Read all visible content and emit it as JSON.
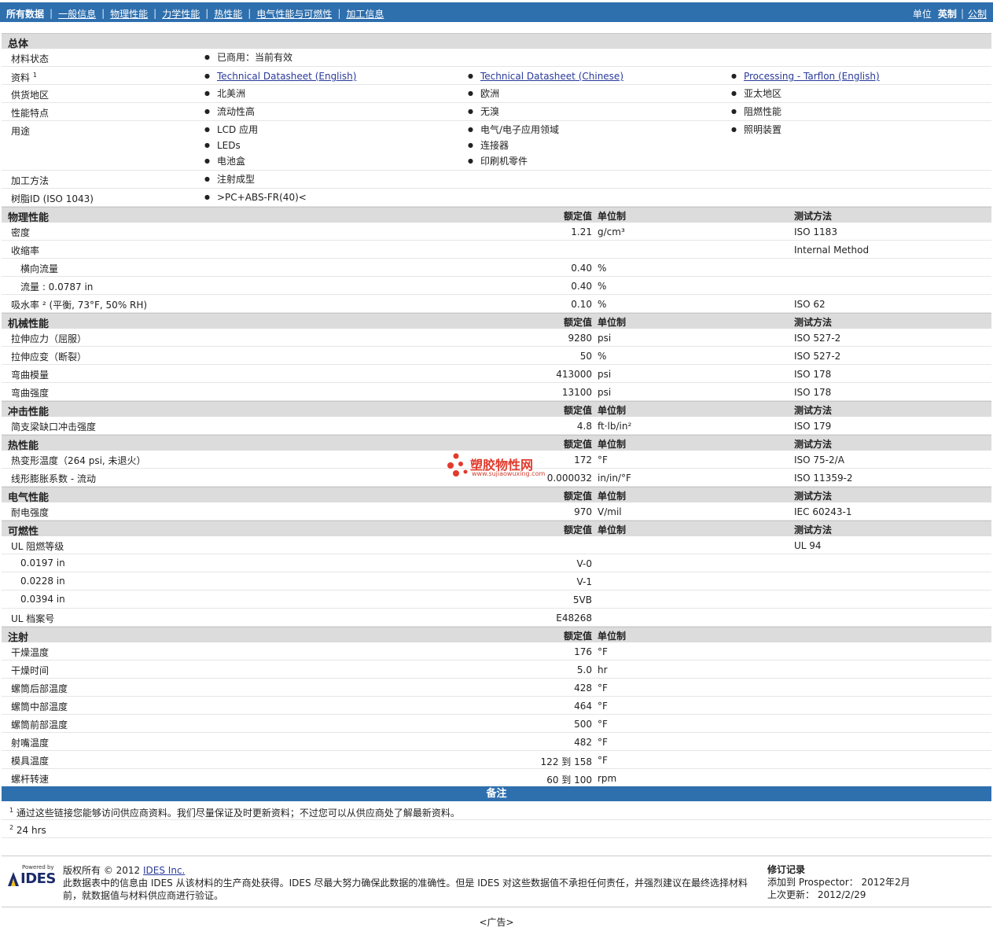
{
  "nav": {
    "tabs": [
      "所有数据",
      "一般信息",
      "物理性能",
      "力学性能",
      "热性能",
      "电气性能与可燃性",
      "加工信息"
    ],
    "units_label": "单位",
    "unit_selected": "英制",
    "unit_other": "公制"
  },
  "headers": {
    "value": "额定值",
    "unit": "单位制",
    "method": "测试方法"
  },
  "general": {
    "title": "总体",
    "status_label": "材料状态",
    "status": "已商用：当前有效",
    "docs_label": "资料",
    "docs_sup": "1",
    "docs": [
      "Technical Datasheet (English)",
      "Technical Datasheet (Chinese)",
      "Processing - Tarflon (English)"
    ],
    "region_label": "供货地区",
    "regions": [
      "北美洲",
      "欧洲",
      "亚太地区"
    ],
    "features_label": "性能特点",
    "features": [
      "流动性高",
      "无溴",
      "阻燃性能"
    ],
    "uses_label": "用途",
    "uses_col1": [
      "LCD 应用",
      "LEDs",
      "电池盒"
    ],
    "uses_col2": [
      "电气/电子应用领域",
      "连接器",
      "印刷机零件"
    ],
    "uses_col3": [
      "照明装置"
    ],
    "process_label": "加工方法",
    "process": "注射成型",
    "resin_label": "树脂ID (ISO 1043)",
    "resin": ">PC+ABS-FR(40)<"
  },
  "physical": {
    "title": "物理性能",
    "rows": [
      {
        "label": "密度",
        "value": "1.21",
        "unit": "g/cm³",
        "method": "ISO 1183",
        "indent": false
      },
      {
        "label": "收缩率",
        "value": "",
        "unit": "",
        "method": "Internal Method",
        "indent": false
      },
      {
        "label": "横向流量",
        "value": "0.40",
        "unit": "%",
        "method": "",
        "indent": true
      },
      {
        "label": "流量 : 0.0787 in",
        "value": "0.40",
        "unit": "%",
        "method": "",
        "indent": true
      },
      {
        "label": "吸水率 ² (平衡, 73°F, 50% RH)",
        "value": "0.10",
        "unit": "%",
        "method": "ISO 62",
        "indent": false
      }
    ]
  },
  "mechanical": {
    "title": "机械性能",
    "rows": [
      {
        "label": "拉伸应力（屈服）",
        "value": "9280",
        "unit": "psi",
        "method": "ISO 527-2"
      },
      {
        "label": "拉伸应变（断裂）",
        "value": "50",
        "unit": "%",
        "method": "ISO 527-2"
      },
      {
        "label": "弯曲模量",
        "value": "413000",
        "unit": "psi",
        "method": "ISO 178"
      },
      {
        "label": "弯曲强度",
        "value": "13100",
        "unit": "psi",
        "method": "ISO 178"
      }
    ]
  },
  "impact": {
    "title": "冲击性能",
    "rows": [
      {
        "label": "简支梁缺口冲击强度",
        "value": "4.8",
        "unit": "ft·lb/in²",
        "method": "ISO 179"
      }
    ]
  },
  "thermal": {
    "title": "热性能",
    "rows": [
      {
        "label": "热变形温度（264 psi, 未退火）",
        "value": "172",
        "unit": "°F",
        "method": "ISO 75-2/A"
      },
      {
        "label": "线形膨胀系数 - 流动",
        "value": "0.000032",
        "unit": "in/in/°F",
        "method": "ISO 11359-2"
      }
    ]
  },
  "electrical": {
    "title": "电气性能",
    "rows": [
      {
        "label": "耐电强度",
        "value": "970",
        "unit": "V/mil",
        "method": "IEC 60243-1"
      }
    ]
  },
  "flammability": {
    "title": "可燃性",
    "rows": [
      {
        "label": "UL 阻燃等级",
        "value": "",
        "unit": "",
        "method": "UL 94",
        "indent": false
      },
      {
        "label": "0.0197 in",
        "value": "V-0",
        "unit": "",
        "method": "",
        "indent": true
      },
      {
        "label": "0.0228 in",
        "value": "V-1",
        "unit": "",
        "method": "",
        "indent": true
      },
      {
        "label": "0.0394 in",
        "value": "5VB",
        "unit": "",
        "method": "",
        "indent": true
      },
      {
        "label": "UL 档案号",
        "value": "E48268",
        "unit": "",
        "method": "",
        "indent": false
      }
    ]
  },
  "injection": {
    "title": "注射",
    "rows": [
      {
        "label": "干燥温度",
        "value": "176",
        "unit": "°F"
      },
      {
        "label": "干燥时间",
        "value": "5.0",
        "unit": "hr"
      },
      {
        "label": "螺筒后部温度",
        "value": "428",
        "unit": "°F"
      },
      {
        "label": "螺筒中部温度",
        "value": "464",
        "unit": "°F"
      },
      {
        "label": "螺筒前部温度",
        "value": "500",
        "unit": "°F"
      },
      {
        "label": "射嘴温度",
        "value": "482",
        "unit": "°F"
      },
      {
        "label": "模具温度",
        "value": "122 到  158",
        "unit": "°F"
      },
      {
        "label": "螺杆转速",
        "value": "60 到  100",
        "unit": "rpm"
      }
    ]
  },
  "notes": {
    "title": "备注",
    "items": [
      {
        "sup": "1",
        "text": "通过这些链接您能够访问供应商资料。我们尽量保证及时更新资料；不过您可以从供应商处了解最新资料。"
      },
      {
        "sup": "2",
        "text": "24 hrs"
      }
    ]
  },
  "footer": {
    "powered_by": "Powered by",
    "logo": "IDES",
    "copyright_prefix": "版权所有  © 2012",
    "company": "IDES Inc.",
    "disclaimer": "此数据表中的信息由 IDES 从该材料的生产商处获得。IDES 尽最大努力确保此数据的准确性。但是 IDES 对这些数据值不承担任何责任，并强烈建议在最终选择材料前，就数据值与材料供应商进行验证。",
    "revision_title": "修订记录",
    "added": "添加到 Prospector：  2012年2月",
    "updated": "上次更新：  2012/2/29"
  },
  "watermark": {
    "name": "塑胶物性网",
    "url": "www.sujiaowuxing.com"
  },
  "ad": "<广告>"
}
